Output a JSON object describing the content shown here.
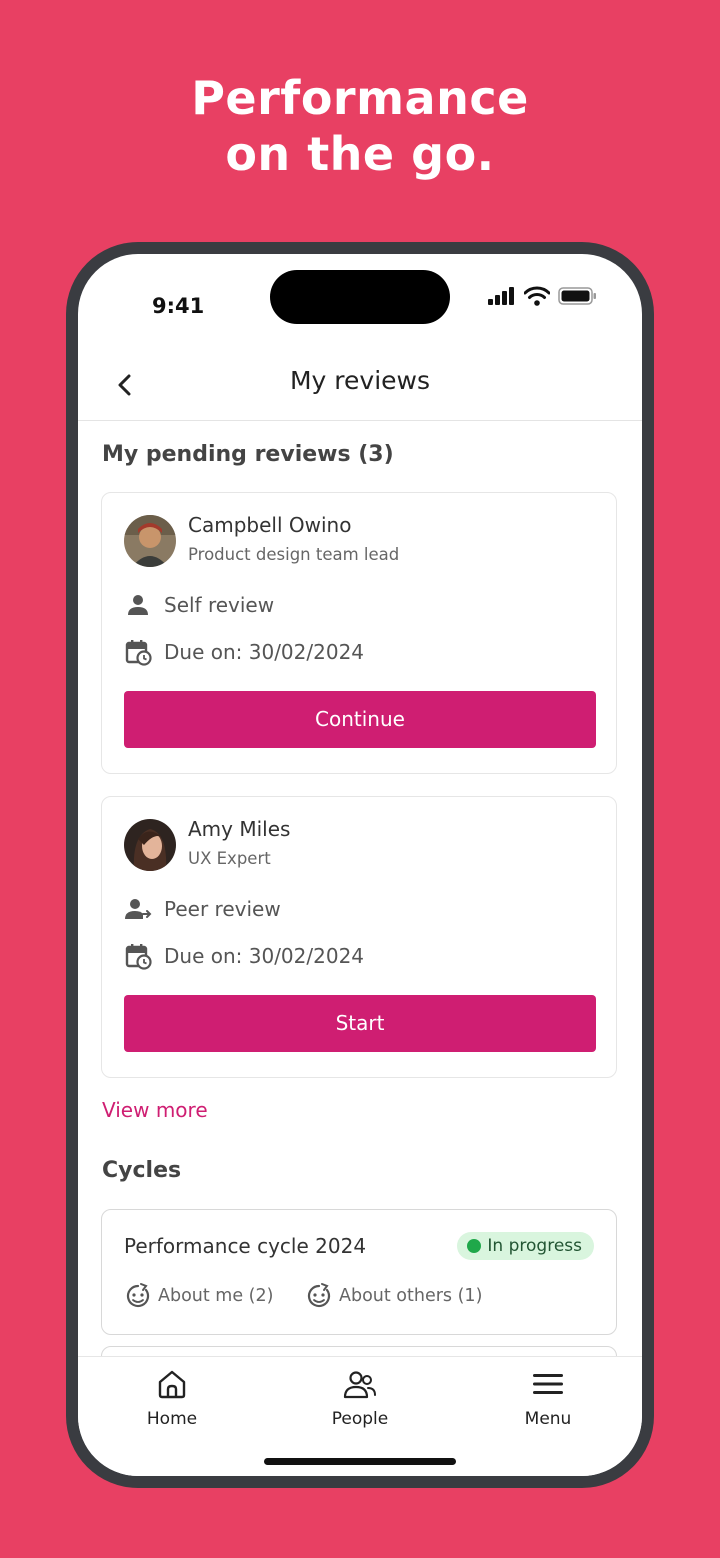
{
  "headline": {
    "line1": "Performance",
    "line2": "on the go."
  },
  "status_bar": {
    "time": "9:41"
  },
  "nav": {
    "title": "My reviews"
  },
  "pending": {
    "heading": "My pending reviews (3)",
    "reviews": [
      {
        "name": "Campbell Owino",
        "role": "Product design team lead",
        "type": "Self review",
        "due": "Due on: 30/02/2024",
        "action": "Continue"
      },
      {
        "name": "Amy Miles",
        "role": "UX Expert",
        "type": "Peer review",
        "due": "Due on: 30/02/2024",
        "action": "Start"
      }
    ],
    "view_more": "View more"
  },
  "cycles": {
    "heading": "Cycles",
    "items": [
      {
        "title": "Performance cycle 2024",
        "status": "In progress",
        "about_me": "About me (2)",
        "about_others": "About others (1)"
      }
    ]
  },
  "tabbar": {
    "items": [
      {
        "label": "Home",
        "icon": "home-icon"
      },
      {
        "label": "People",
        "icon": "people-icon"
      },
      {
        "label": "Menu",
        "icon": "menu-icon"
      }
    ]
  },
  "colors": {
    "background": "#E84063",
    "accent": "#CF1E72",
    "status_green": "#1FA84A"
  }
}
